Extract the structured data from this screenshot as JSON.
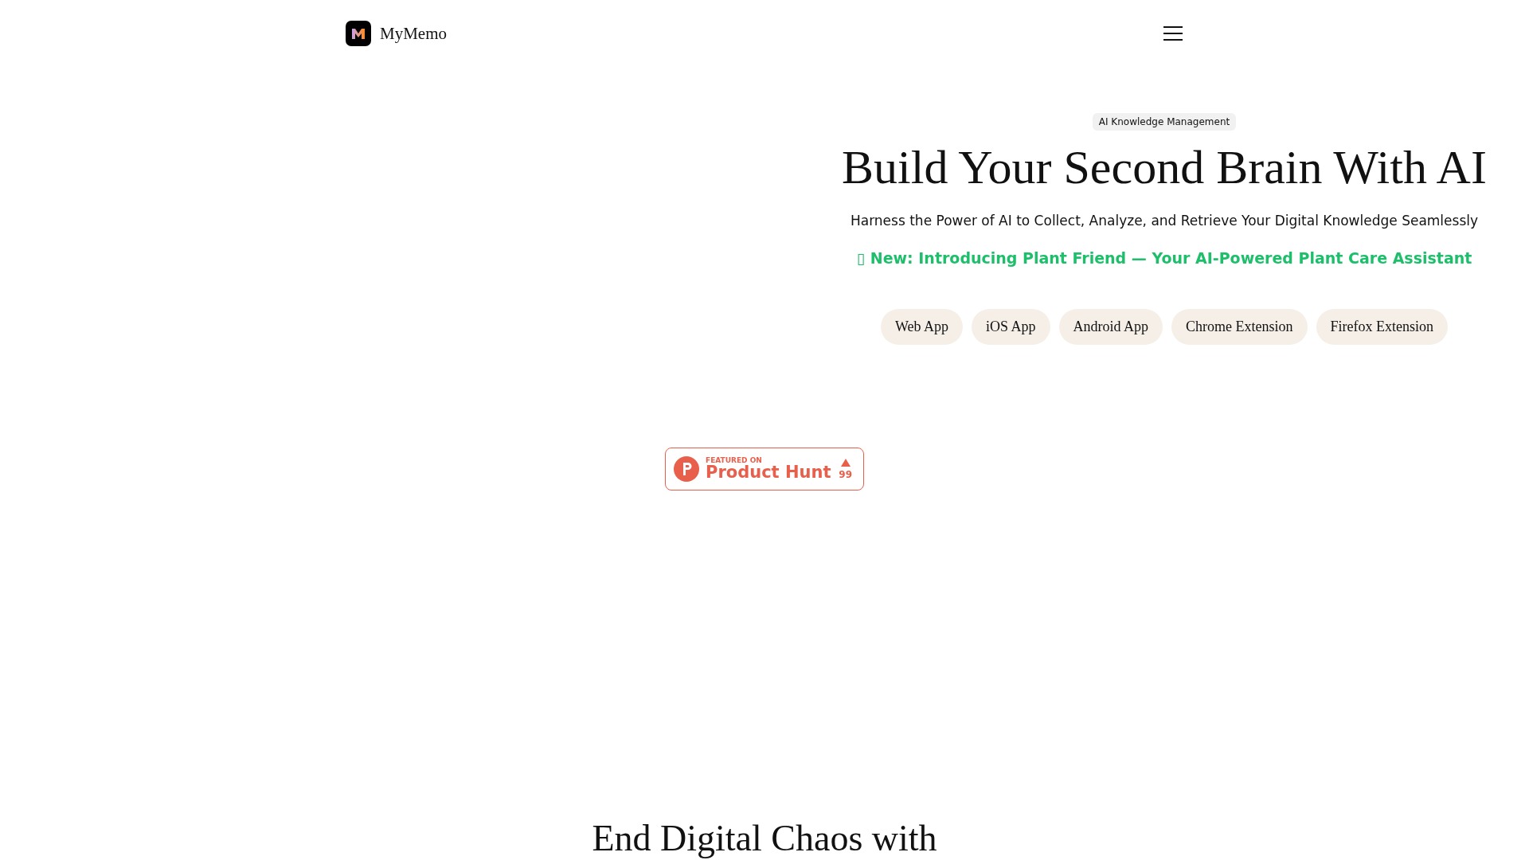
{
  "header": {
    "brand": "MyMemo"
  },
  "hero": {
    "badge": "AI Knowledge Management",
    "title": "Build Your Second Brain With AI",
    "subtitle": "Harness the Power of AI to Collect, Analyze, and Retrieve Your Digital Knowledge Seamlessly",
    "announcement": "▯ New: Introducing Plant Friend — Your AI-Powered Plant Care Assistant",
    "platforms": [
      "Web App",
      "iOS App",
      "Android App",
      "Chrome Extension",
      "Firefox Extension"
    ]
  },
  "product_hunt": {
    "caption": "FEATURED ON",
    "name": "Product Hunt",
    "votes": "99"
  },
  "next_section": {
    "title": "End Digital Chaos with"
  }
}
